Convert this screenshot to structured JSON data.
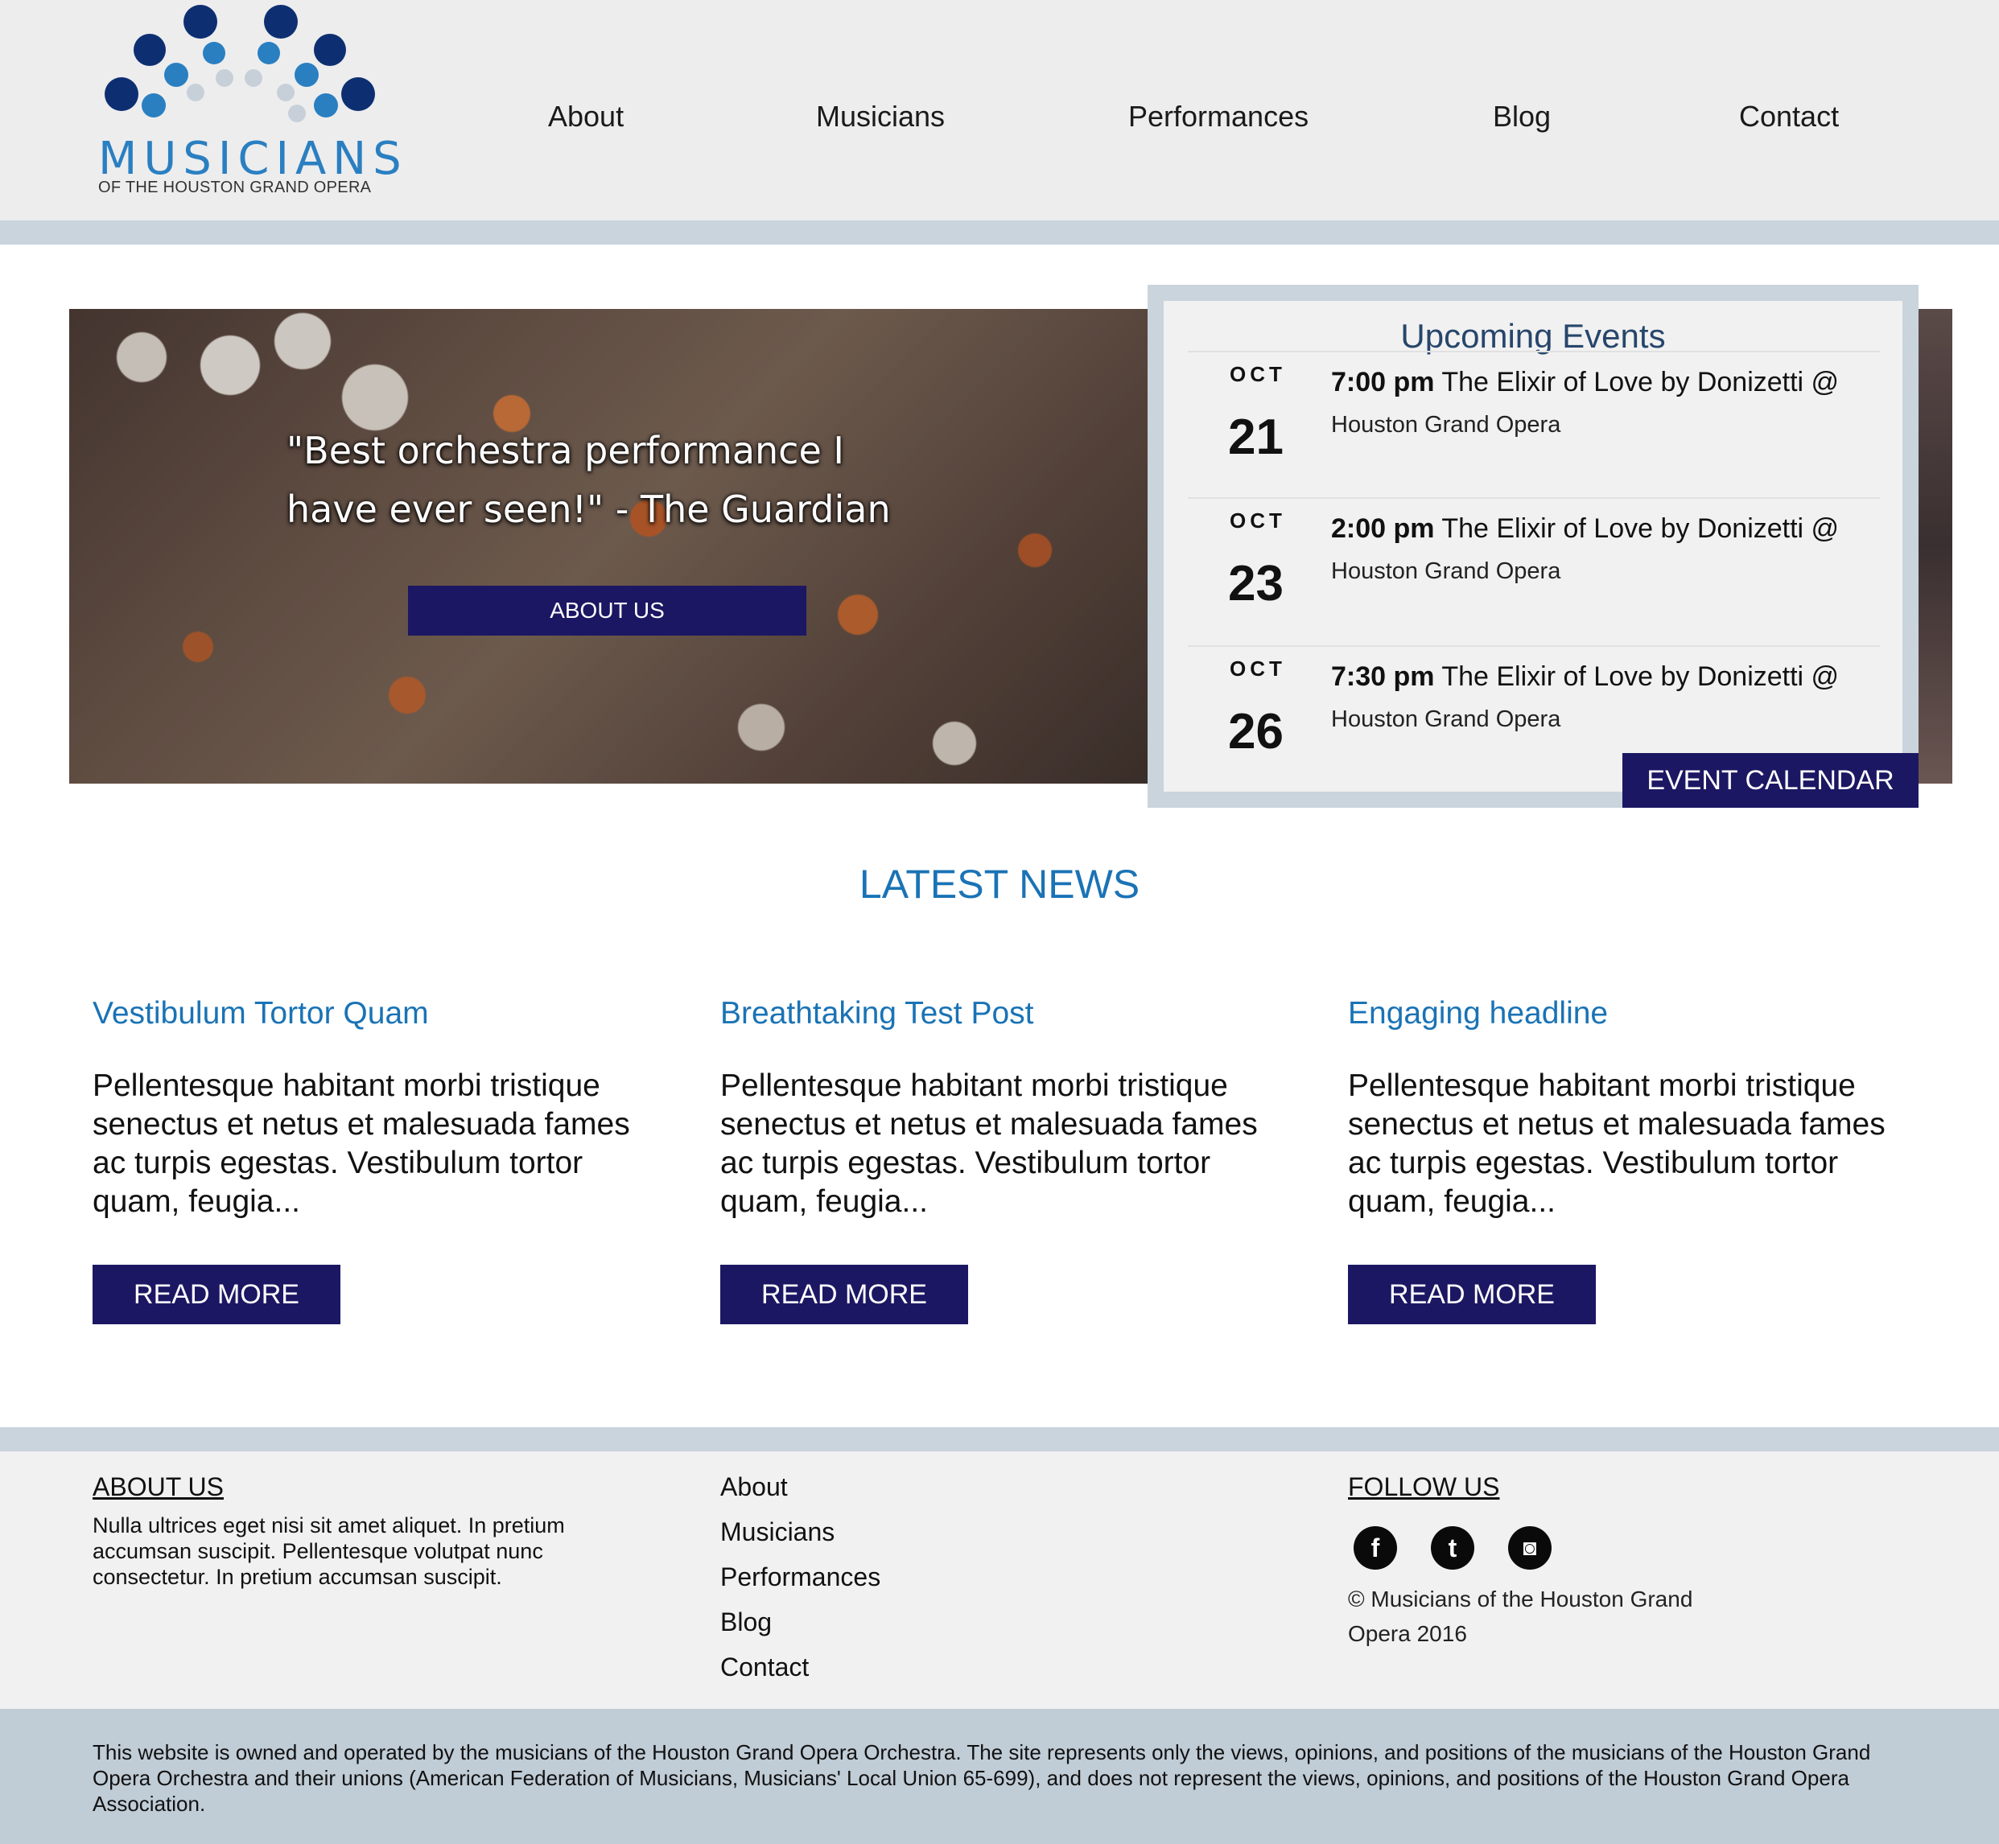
{
  "logo": {
    "wordmark": "MUSICIANS",
    "subtitle": "OF THE HOUSTON GRAND OPERA",
    "colors": {
      "dark": "#0d2f72",
      "mid": "#2a7fc1",
      "light": "#c7d0d9"
    }
  },
  "nav": {
    "items": [
      "About",
      "Musicians",
      "Performances",
      "Blog",
      "Contact"
    ]
  },
  "hero": {
    "quote": "\"Best orchestra performance I have ever seen!\" - The Guardian",
    "button_label": "ABOUT US"
  },
  "events": {
    "title": "Upcoming Events",
    "items": [
      {
        "month": "OCT",
        "day": "21",
        "time": "7:00 pm",
        "title": "The Elixir of Love by Donizetti @",
        "location": "Houston Grand Opera"
      },
      {
        "month": "OCT",
        "day": "23",
        "time": "2:00 pm",
        "title": "The Elixir of Love by Donizetti @",
        "location": "Houston Grand Opera"
      },
      {
        "month": "OCT",
        "day": "26",
        "time": "7:30 pm",
        "title": "The Elixir of Love by Donizetti @",
        "location": "Houston Grand Opera"
      }
    ],
    "calendar_button": "EVENT CALENDAR"
  },
  "news": {
    "heading": "LATEST NEWS",
    "posts": [
      {
        "title": "Vestibulum Tortor Quam",
        "excerpt": "Pellentesque habitant morbi tristique senectus et netus et malesuada fames ac turpis egestas. Vestibulum tortor quam, feugia...",
        "button": "READ MORE"
      },
      {
        "title": "Breathtaking Test Post",
        "excerpt": "Pellentesque habitant morbi tristique senectus et netus et malesuada fames ac turpis egestas. Vestibulum tortor quam, feugia...",
        "button": "READ MORE"
      },
      {
        "title": "Engaging headline",
        "excerpt": "Pellentesque habitant morbi tristique senectus et netus et malesuada fames ac turpis egestas. Vestibulum tortor quam, feugia...",
        "button": "READ MORE"
      }
    ]
  },
  "footer": {
    "about_heading": "ABOUT US",
    "about_text": "Nulla ultrices eget nisi sit amet aliquet. In pretium accumsan suscipit. Pellentesque volutpat nunc consectetur. In pretium accumsan suscipit.",
    "links": [
      "About",
      "Musicians",
      "Performances",
      "Blog",
      "Contact"
    ],
    "follow_heading": "FOLLOW US",
    "social": [
      {
        "icon": "facebook-icon",
        "glyph": "f"
      },
      {
        "icon": "twitter-icon",
        "glyph": "t"
      },
      {
        "icon": "instagram-icon",
        "glyph": "◙"
      }
    ],
    "copyright": "© Musicians of the Houston Grand Opera 2016",
    "disclaimer": "This website is owned and operated by the musicians of the Houston Grand Opera Orchestra. The site represents only the views, opinions, and positions of the musicians of the Houston Grand Opera Orchestra and their unions (American Federation of Musicians, Musicians' Local Union 65-699), and does not represent the views, opinions, and positions of the Houston Grand Opera Association."
  },
  "colors": {
    "accent_blue": "#1a73b5",
    "button_navy": "#1c1763",
    "strip_gray": "#c9d4dd",
    "header_bg": "#ededee"
  }
}
